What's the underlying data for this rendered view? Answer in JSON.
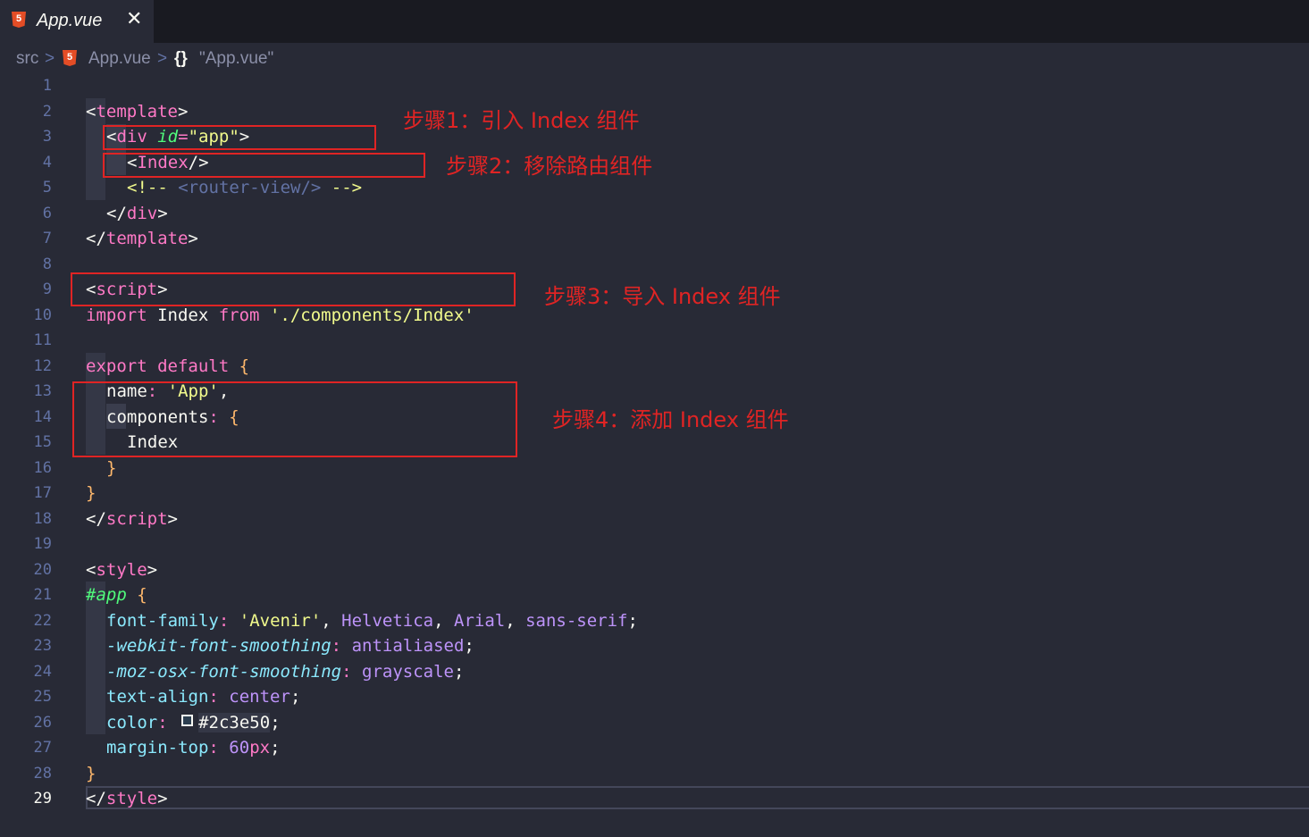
{
  "tab": {
    "title": "App.vue",
    "close": "✕",
    "icon_badge": "5"
  },
  "breadcrumb": {
    "folder": "src",
    "file": "App.vue",
    "braces": "{}",
    "symbol": "\"App.vue\"",
    "sep": ">"
  },
  "line_numbers": [
    "1",
    "2",
    "3",
    "4",
    "5",
    "6",
    "7",
    "8",
    "9",
    "10",
    "11",
    "12",
    "13",
    "14",
    "15",
    "16",
    "17",
    "18",
    "19",
    "20",
    "21",
    "22",
    "23",
    "24",
    "25",
    "26",
    "27",
    "28",
    "29"
  ],
  "code": {
    "template_open": "template",
    "div_tag": "div",
    "div_attr": "id",
    "div_val": "\"app\"",
    "index_tag": "Index",
    "comment_open": "<!--",
    "comment_body": " <router-view/> ",
    "comment_close": "-->",
    "import_kw": "import",
    "import_name": " Index ",
    "from_kw": "from",
    "import_path": "'./components/Index'",
    "script_tag": "script",
    "export_kw": "export",
    "default_kw": "default",
    "name_key": "name",
    "name_val": "'App'",
    "components_key": "components",
    "index_ref": "Index",
    "style_tag": "style",
    "selector": "#app",
    "ff_prop": "font-family",
    "ff_avenir": "'Avenir'",
    "ff_helvetica": "Helvetica",
    "ff_arial": "Arial",
    "ff_sans": "sans-serif",
    "wfs_prop": "-webkit-font-smoothing",
    "wfs_val": "antialiased",
    "mfs_prop": "-moz-osx-font-smoothing",
    "mfs_val": "grayscale",
    "ta_prop": "text-align",
    "ta_val": "center",
    "color_prop": "color",
    "color_val": "#2c3e50",
    "mt_prop": "margin-top",
    "mt_num": "60",
    "mt_unit": "px"
  },
  "annotations": {
    "step1": "步骤1：引入 Index 组件",
    "step2": "步骤2：移除路由组件",
    "step3": "步骤3：导入 Index 组件",
    "step4": "步骤4：添加 Index 组件"
  },
  "colors": {
    "background": "#282a36",
    "annotation_red": "#e02424",
    "swatch": "#2c3e50"
  }
}
